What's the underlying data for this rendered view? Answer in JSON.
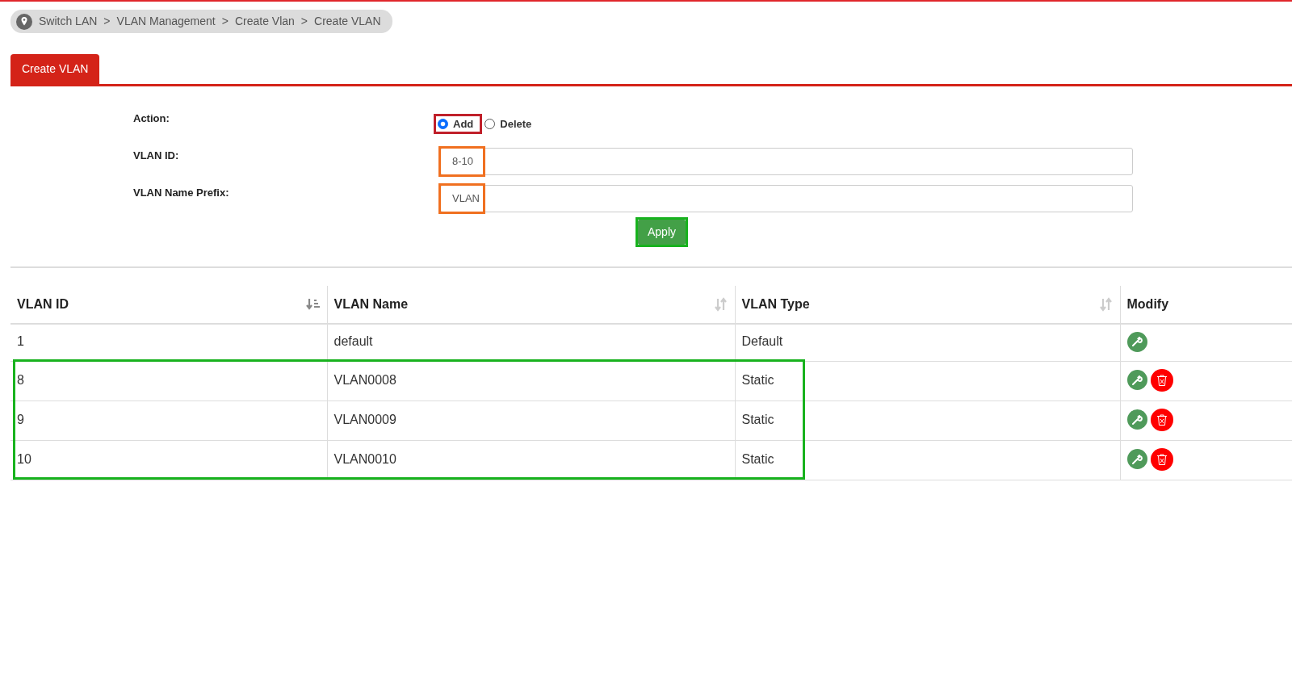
{
  "breadcrumb": [
    {
      "label": "Switch LAN"
    },
    {
      "separator": ">",
      "label": "VLAN Management"
    },
    {
      "separator": ">",
      "label": "Create Vlan"
    },
    {
      "separator": ">",
      "label": "Create VLAN"
    }
  ],
  "tabs": [
    {
      "label": "Create VLAN",
      "selected": true
    }
  ],
  "form": {
    "action": {
      "label": "Action:",
      "highlighted": true,
      "options": [
        {
          "label": "Add",
          "selected": true
        },
        {
          "label": "Delete",
          "selected": false
        }
      ]
    },
    "vlan_id": {
      "label": "VLAN ID:",
      "value": "8-10",
      "highlighted": true
    },
    "name_prefix": {
      "label": "VLAN Name Prefix:",
      "value": "VLAN",
      "highlighted": true
    },
    "apply": {
      "label": "Apply",
      "highlighted": true
    }
  },
  "table": {
    "columns": [
      {
        "label": "VLAN ID",
        "kind": "sorted"
      },
      {
        "label": "VLAN Name",
        "kind": "sortable"
      },
      {
        "label": "VLAN Type",
        "kind": "sortable"
      },
      {
        "label": "Modify",
        "kind": "plain"
      }
    ],
    "rows": [
      {
        "cells": [
          "1",
          "default",
          "Default"
        ],
        "deletable": false,
        "highlighted": false
      },
      {
        "cells": [
          "8",
          "VLAN0008",
          "Static"
        ],
        "deletable": true,
        "highlighted": true
      },
      {
        "cells": [
          "9",
          "VLAN0009",
          "Static"
        ],
        "deletable": true,
        "highlighted": true
      },
      {
        "cells": [
          "10",
          "VLAN0010",
          "Static"
        ],
        "deletable": true,
        "highlighted": true
      }
    ]
  }
}
